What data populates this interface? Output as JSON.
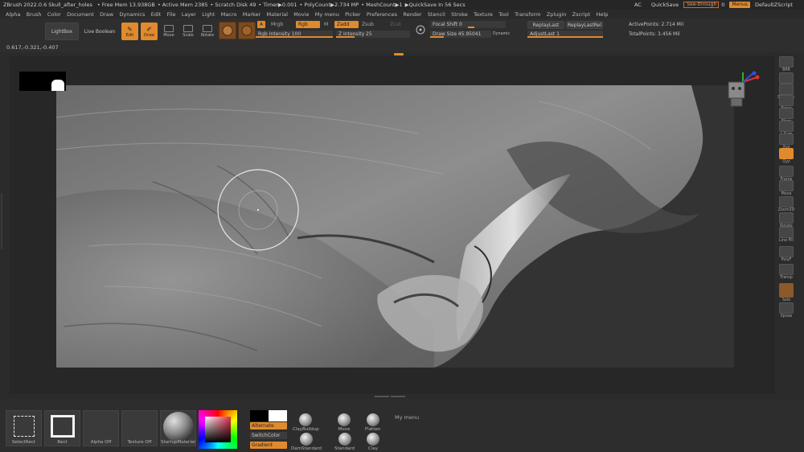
{
  "titlebar": {
    "app": "ZBrush 2022.0.6 Skull_after_holes",
    "free_mem": "• Free Mem 13.938GB",
    "active_mem": "• Active Mem 2385",
    "scratch": "• Scratch Disk 49",
    "timer": "• Timer▶0.001",
    "polycount": "• PolyCount▶2.734 MP",
    "meshcount": "• MeshCount▶1",
    "quicksave": "▶QuickSave In 56 Secs",
    "ac": "AC",
    "quicksave_btn": "QuickSave",
    "see_through": "See-through",
    "see_through_value": "0",
    "menus": "Menus",
    "script": "DefaultZScript"
  },
  "menubar": [
    "Alpha",
    "Brush",
    "Color",
    "Document",
    "Draw",
    "Dynamics",
    "Edit",
    "File",
    "Layer",
    "Light",
    "Macro",
    "Marker",
    "Material",
    "Movie",
    "My menu",
    "Picker",
    "Preferences",
    "Render",
    "Stencil",
    "Stroke",
    "Texture",
    "Tool",
    "Transform",
    "Zplugin",
    "Zscript",
    "Help"
  ],
  "shelf": {
    "lightbox": "LightBox",
    "live_boolean": "Live Boolean",
    "edit": "Edit",
    "draw": "Draw",
    "move": "Move",
    "scale": "Scale",
    "rotate": "Rotate",
    "a": "A",
    "mrgb": "Mrgb",
    "rgb": "Rgb",
    "m": "M",
    "zadd": "Zadd",
    "zsub": "Zsub",
    "zcut": "Zcut",
    "rgb_intensity": "Rgb Intensity 100",
    "z_intensity": "Z Intensity 25",
    "focal_shift": "Focal Shift 0",
    "draw_size": "Draw Size 45.95041",
    "dynamic": "Dynamic",
    "replay_last": "ReplayLast",
    "replay_last_rel": "ReplayLastRel",
    "adjust_last": "AdjustLast 1",
    "active_points": "ActivePoints: 2.714 Mil",
    "total_points": "TotalPoints: 3.456 Mil",
    "coords": "0.617,-0.321,-0.407"
  },
  "brush_cursor": {
    "outer_radius": 50,
    "inner_radius": 24
  },
  "righttray": [
    {
      "name": "bpr",
      "label": "BPR"
    },
    {
      "name": "spix",
      "label": "SPix 3"
    },
    {
      "name": "dynamic",
      "label": "Dynamic"
    },
    {
      "name": "persp",
      "label": "Persp"
    },
    {
      "name": "floor",
      "label": "Floor"
    },
    {
      "name": "local",
      "label": "L.Sym"
    },
    {
      "name": "lsym",
      "label": "Xyz"
    },
    {
      "name": "xyz",
      "label": "Qyz"
    },
    {
      "name": "frame",
      "label": "Frame"
    },
    {
      "name": "move",
      "label": "Move"
    },
    {
      "name": "zoom3d",
      "label": "Zoom3D"
    },
    {
      "name": "rotate",
      "label": "Rotate"
    },
    {
      "name": "linefill",
      "label": "Line Fill"
    },
    {
      "name": "polyf",
      "label": "PolyF"
    },
    {
      "name": "transp",
      "label": "Transp"
    },
    {
      "name": "solo",
      "label": "Solo"
    },
    {
      "name": "xpose",
      "label": "Xpose"
    }
  ],
  "bottom": {
    "slot1": "SelectRect",
    "slot2": "Rect",
    "slot3": "Alpha Off",
    "slot4": "Texture Off",
    "slot5": "StartupMaterial",
    "alternate": "Alternate",
    "switchcolor": "SwitchColor",
    "gradient": "Gradient",
    "brushes": [
      "ClayBuildup",
      "DamStandard",
      "Move",
      "Standard",
      "Flatten",
      "Clay"
    ],
    "my_menu": "My menu"
  },
  "colors": {
    "accent": "#e08a2e",
    "panel": "#2e2e2e",
    "canvas": "#333333"
  }
}
